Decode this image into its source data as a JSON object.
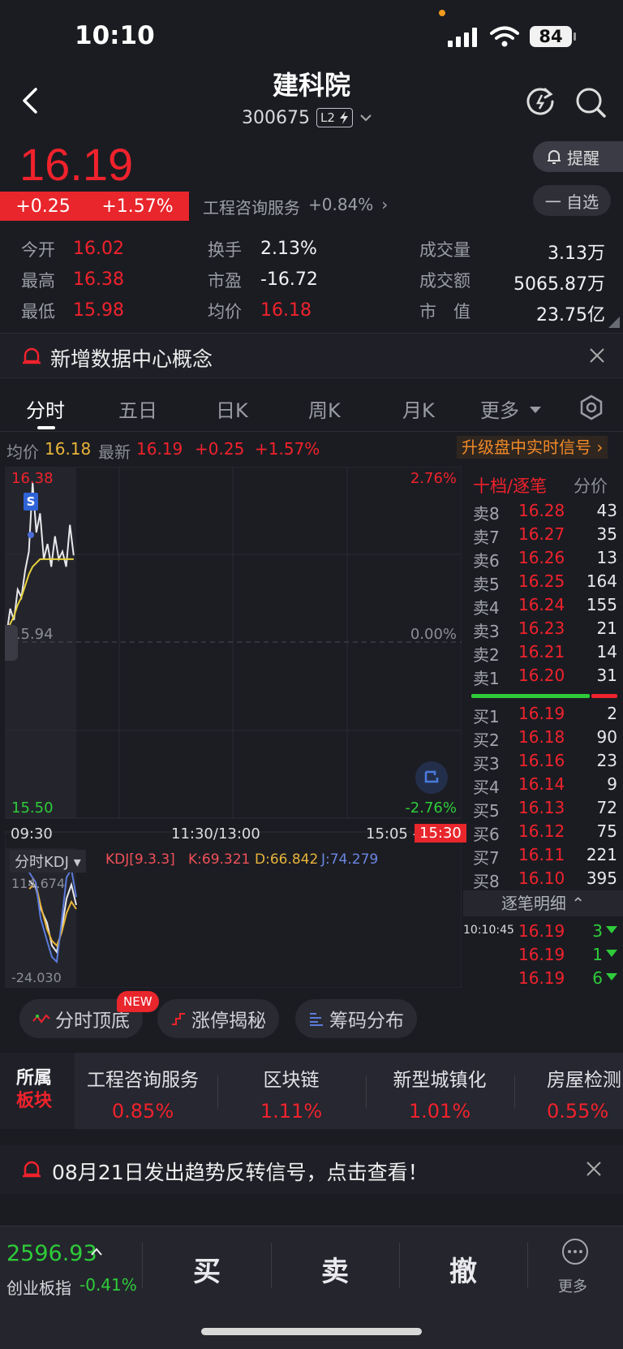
{
  "status_bar": {
    "time": "10:10",
    "battery": "84"
  },
  "header": {
    "name": "建科院",
    "code": "300675",
    "level_badge": "L2"
  },
  "price": {
    "last": "16.19",
    "change": "+0.25",
    "change_pct": "+1.57%",
    "industry": "工程咨询服务",
    "industry_pct": "+0.84%",
    "remind_label": "提醒",
    "watch_label": "一 自选"
  },
  "quote": {
    "open_label": "今开",
    "open": "16.02",
    "high_label": "最高",
    "high": "16.38",
    "low_label": "最低",
    "low": "15.98",
    "turnover_label": "换手",
    "turnover": "2.13%",
    "pe_label": "市盈",
    "pe": "-16.72",
    "avg_label": "均价",
    "avg": "16.18",
    "volume_label": "成交量",
    "volume": "3.13万",
    "amount_label": "成交额",
    "amount": "5065.87万",
    "mktcap_label": "市　值",
    "mktcap": "23.75亿"
  },
  "concept_banner": {
    "text": "新增数据中心概念"
  },
  "chart_tabs": [
    "分时",
    "五日",
    "日K",
    "周K",
    "月K",
    "更多"
  ],
  "info_row": {
    "avg_label": "均价",
    "avg": "16.18",
    "latest_label": "最新",
    "latest": "16.19",
    "change": "+0.25",
    "change_pct": "+1.57%",
    "upgrade": "升级盘中实时信号"
  },
  "chart": {
    "y_high": "16.38",
    "y_mid": "15.94",
    "y_low": "15.50",
    "pct_high": "2.76%",
    "pct_mid": "0.00%",
    "pct_low": "-2.76%",
    "t_start": "09:30",
    "t_mid": "11:30/13:00",
    "t_end_left": "15:05 -",
    "t_end": "15:30",
    "s_marker": "S",
    "kdj_tab": "分时KDJ",
    "kdj_params": "KDJ[9.3.3]",
    "kdj_k": "K:69.321",
    "kdj_d": "D:66.842",
    "kdj_j": "J:74.279",
    "kdj_top": "114.674",
    "kdj_bottom": "-24.030"
  },
  "chart_data": {
    "type": "line",
    "series": [
      {
        "name": "分时",
        "values": [
          15.98,
          16.05,
          16.02,
          16.1,
          16.08,
          16.15,
          16.2,
          16.38,
          16.25,
          16.3,
          16.18,
          16.22,
          16.16,
          16.24,
          16.18,
          16.2,
          16.16,
          16.27,
          16.19
        ]
      },
      {
        "name": "均价",
        "values": [
          15.98,
          16.01,
          16.03,
          16.06,
          16.08,
          16.11,
          16.14,
          16.16,
          16.17,
          16.18,
          16.18,
          16.18,
          16.18,
          16.18,
          16.18,
          16.18,
          16.18,
          16.18,
          16.18
        ]
      }
    ],
    "ylim": [
      15.5,
      16.38
    ]
  },
  "orderbook": {
    "title": "十档/逐笔",
    "title_right": "分价",
    "asks": [
      {
        "label": "卖8",
        "price": "16.28",
        "vol": "43"
      },
      {
        "label": "卖7",
        "price": "16.27",
        "vol": "35"
      },
      {
        "label": "卖6",
        "price": "16.26",
        "vol": "13"
      },
      {
        "label": "卖5",
        "price": "16.25",
        "vol": "164"
      },
      {
        "label": "卖4",
        "price": "16.24",
        "vol": "155"
      },
      {
        "label": "卖3",
        "price": "16.23",
        "vol": "21"
      },
      {
        "label": "卖2",
        "price": "16.21",
        "vol": "14"
      },
      {
        "label": "卖1",
        "price": "16.20",
        "vol": "31"
      }
    ],
    "bids": [
      {
        "label": "买1",
        "price": "16.19",
        "vol": "2"
      },
      {
        "label": "买2",
        "price": "16.18",
        "vol": "90"
      },
      {
        "label": "买3",
        "price": "16.16",
        "vol": "23"
      },
      {
        "label": "买4",
        "price": "16.14",
        "vol": "9"
      },
      {
        "label": "买5",
        "price": "16.13",
        "vol": "72"
      },
      {
        "label": "买6",
        "price": "16.12",
        "vol": "75"
      },
      {
        "label": "买7",
        "price": "16.11",
        "vol": "221"
      },
      {
        "label": "买8",
        "price": "16.10",
        "vol": "395"
      }
    ],
    "detail_label": "逐笔明细",
    "ticks": [
      {
        "time": "10:10:45",
        "price": "16.19",
        "vol": "3"
      },
      {
        "time": "",
        "price": "16.19",
        "vol": "1"
      },
      {
        "time": "",
        "price": "16.19",
        "vol": "6"
      }
    ]
  },
  "tools": {
    "chip1": "分时顶底",
    "chip1_badge": "NEW",
    "chip2": "涨停揭秘",
    "chip3": "筹码分布"
  },
  "sectors": {
    "title_line1": "所属",
    "title_line2": "板块",
    "items": [
      {
        "name": "工程咨询服务",
        "pct": "0.85%"
      },
      {
        "name": "区块链",
        "pct": "1.11%"
      },
      {
        "name": "新型城镇化",
        "pct": "1.01%"
      },
      {
        "name": "房屋检测",
        "pct": "0.55%"
      }
    ]
  },
  "signal_banner": {
    "text": "08月21日发出趋势反转信号，点击查看！"
  },
  "bottom_bar": {
    "index_value": "2596.93",
    "index_name": "创业板指",
    "index_pct": "-0.41%",
    "buy": "买",
    "sell": "卖",
    "cancel": "撤",
    "more": "更多"
  }
}
